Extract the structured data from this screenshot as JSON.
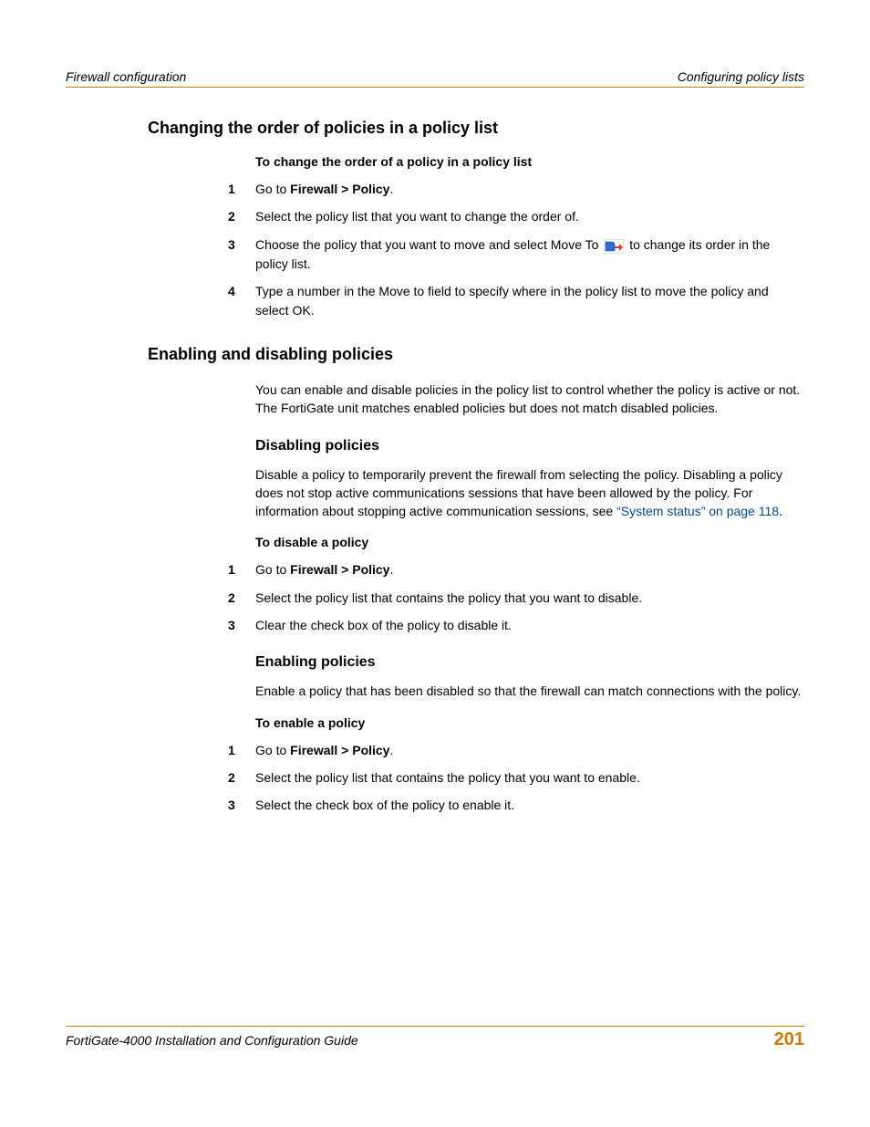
{
  "header": {
    "left": "Firewall configuration",
    "right": "Configuring policy lists"
  },
  "footer": {
    "title": "FortiGate-4000 Installation and Configuration Guide",
    "page": "201"
  },
  "nav_path": "Firewall > Policy",
  "goto_prefix": "Go to ",
  "goto_suffix": ".",
  "sec1": {
    "heading": "Changing the order of policies in a policy list",
    "subhead": "To change the order of a policy in a policy list",
    "s2": "Select the policy list that you want to change the order of.",
    "s3a": "Choose the policy that you want to move and select Move To ",
    "s3b": " to change its order in the policy list.",
    "s4": "Type a number in the Move to field to specify where in the policy list to move the policy and select OK."
  },
  "sec2": {
    "heading": "Enabling and disabling policies",
    "intro": "You can enable and disable policies in the policy list to control whether the policy is active or not. The FortiGate unit matches enabled policies but does not match disabled policies."
  },
  "sec3": {
    "heading": "Disabling policies",
    "p1a": "Disable a policy to temporarily prevent the firewall from selecting the policy. Disabling a policy does not stop active communications sessions that have been allowed by the policy. For information about stopping active communication sessions, see ",
    "link": "“System status” on page 118",
    "p1b": ".",
    "subhead": "To disable a policy",
    "s2": "Select the policy list that contains the policy that you want to disable.",
    "s3": "Clear the check box of the policy to disable it."
  },
  "sec4": {
    "heading": "Enabling policies",
    "intro": "Enable a policy that has been disabled so that the firewall can match connections with the policy.",
    "subhead": "To enable a policy",
    "s2": "Select the policy list that contains the policy that you want to enable.",
    "s3": "Select the check box of the policy to enable it."
  },
  "nums": {
    "n1": "1",
    "n2": "2",
    "n3": "3",
    "n4": "4"
  }
}
